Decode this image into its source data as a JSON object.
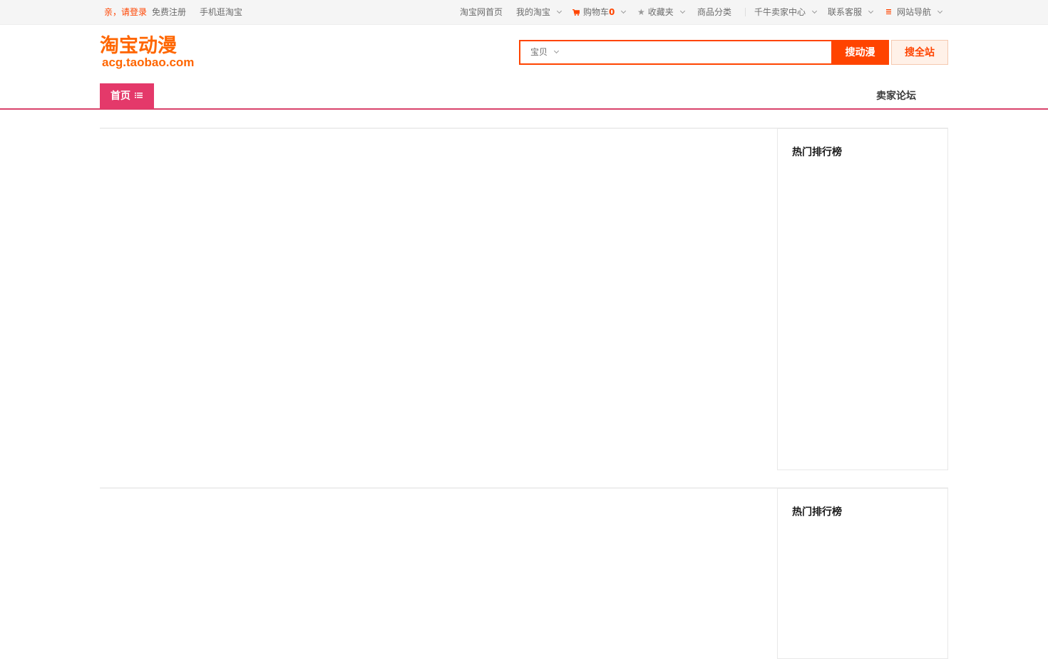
{
  "topbar": {
    "login": "亲，请登录",
    "register": "免费注册",
    "mobile": "手机逛淘宝",
    "taobao_home": "淘宝网首页",
    "my_taobao": "我的淘宝",
    "cart_label": "购物车",
    "cart_count": "0",
    "favorites": "收藏夹",
    "categories": "商品分类",
    "seller_center": "千牛卖家中心",
    "customer_service": "联系客服",
    "site_nav": "网站导航"
  },
  "header": {
    "logo_cn": "淘宝动漫",
    "logo_en": "acg.taobao.com"
  },
  "search": {
    "type_selected": "宝贝",
    "query": "",
    "btn_acg": "搜动漫",
    "btn_all": "搜全站"
  },
  "nav": {
    "home": "首页",
    "forum": "卖家论坛"
  },
  "sections": [
    {
      "rank_title": "热门排行榜"
    },
    {
      "rank_title": "热门排行榜"
    }
  ],
  "colors": {
    "accent": "#ff4400",
    "nav_pink": "#e4396a"
  }
}
